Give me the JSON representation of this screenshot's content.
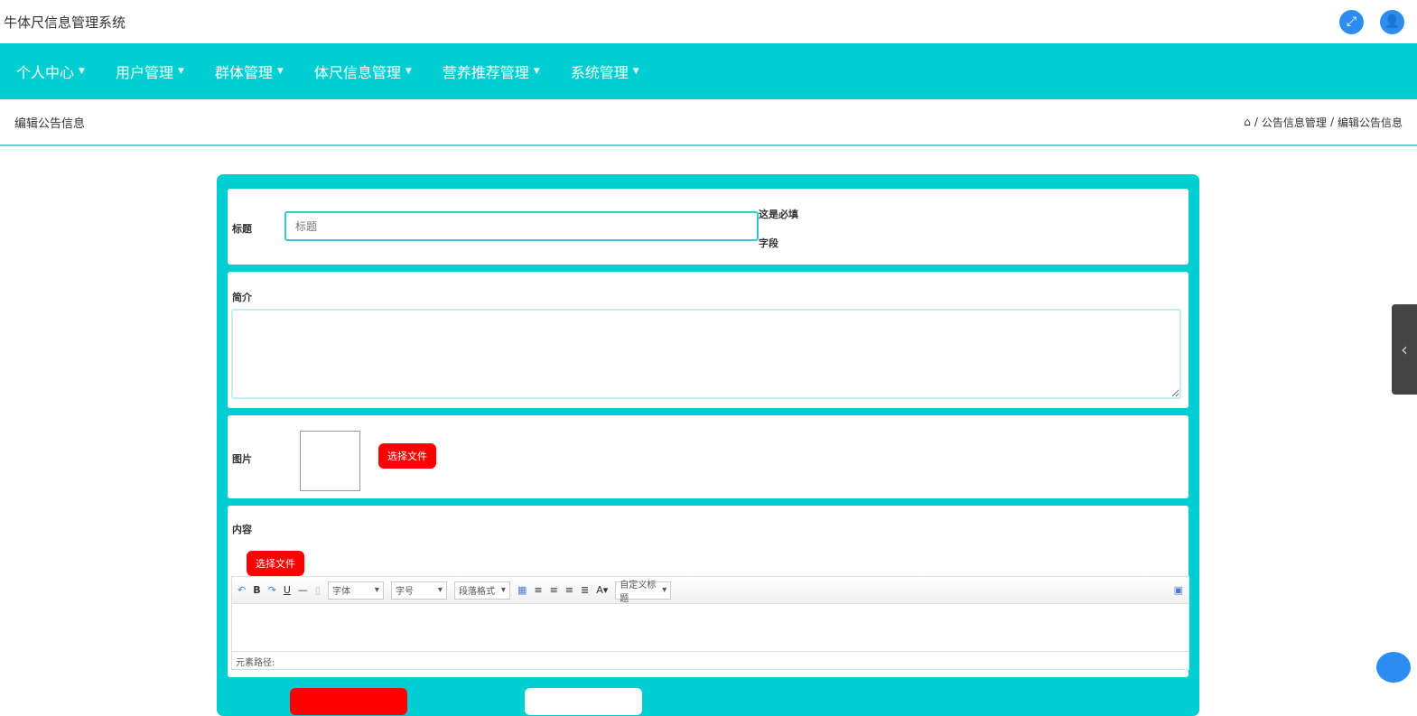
{
  "app": {
    "title": "牛体尺信息管理系统"
  },
  "nav": [
    "个人中心",
    "用户管理",
    "群体管理",
    "体尺信息管理",
    "营养推荐管理",
    "系统管理"
  ],
  "page": {
    "title": "编辑公告信息",
    "crumbs": [
      "公告信息管理",
      "编辑公告信息"
    ]
  },
  "form": {
    "title_label": "标题",
    "title_placeholder": "标题",
    "required_line1": "这是必填",
    "required_line2": "字段",
    "intro_label": "简介",
    "image_label": "图片",
    "choose_file": "选择文件",
    "content_label": "内容",
    "editor": {
      "font": "字体",
      "size": "字号",
      "para": "段落格式",
      "custom": "自定义标题",
      "path": "元素路径:"
    }
  }
}
